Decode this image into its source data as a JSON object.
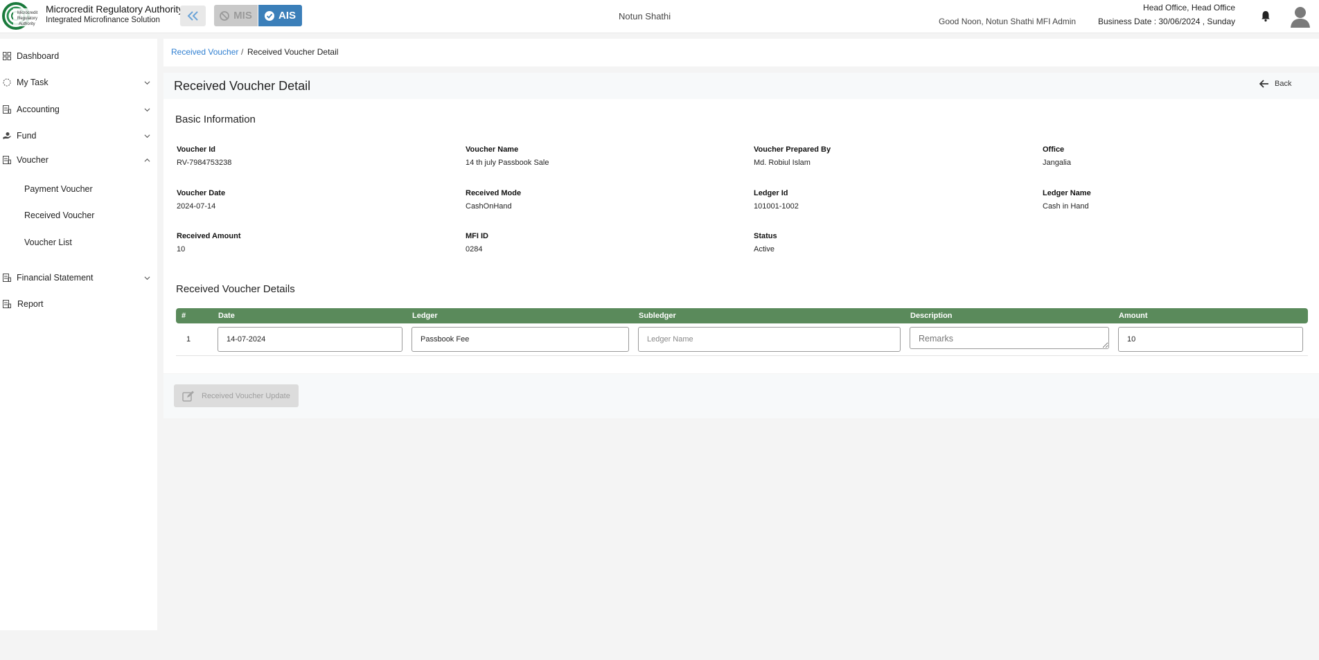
{
  "header": {
    "brand_title": "Microcredit Regulatory Authority",
    "brand_subtitle": "Integrated Microfinance Solution",
    "logo_text": "Microcredit Regulatory Authority",
    "mis_label": "MIS",
    "ais_label": "AIS",
    "org_name": "Notun Shathi",
    "greeting": "Good Noon, Notun Shathi MFI Admin",
    "office": "Head Office, Head Office",
    "business_date": "Business Date : 30/06/2024 , Sunday"
  },
  "sidebar": {
    "items": [
      {
        "label": "Dashboard"
      },
      {
        "label": "My Task"
      },
      {
        "label": "Accounting"
      },
      {
        "label": "Fund"
      },
      {
        "label": "Voucher"
      },
      {
        "label": "Financial Statement"
      },
      {
        "label": "Report"
      }
    ],
    "voucher_sub": [
      {
        "label": "Payment Voucher"
      },
      {
        "label": "Received Voucher"
      },
      {
        "label": "Voucher List"
      }
    ]
  },
  "breadcrumb": {
    "link": "Received Voucher",
    "separator": "/",
    "current": "Received Voucher Detail"
  },
  "page": {
    "title": "Received Voucher Detail",
    "back_label": "Back"
  },
  "basic_info": {
    "title": "Basic Information",
    "fields": [
      {
        "label": "Voucher Id",
        "value": "RV-7984753238"
      },
      {
        "label": "Voucher Name",
        "value": "14 th july Passbook Sale"
      },
      {
        "label": "Voucher Prepared By",
        "value": "Md. Robiul Islam"
      },
      {
        "label": "Office",
        "value": "Jangalia"
      },
      {
        "label": "Voucher Date",
        "value": "2024-07-14"
      },
      {
        "label": "Received Mode",
        "value": "CashOnHand"
      },
      {
        "label": "Ledger Id",
        "value": "101001-1002"
      },
      {
        "label": "Ledger Name",
        "value": "Cash in Hand"
      },
      {
        "label": "Received Amount",
        "value": "10"
      },
      {
        "label": "MFI ID",
        "value": "0284"
      },
      {
        "label": "Status",
        "value": "Active"
      }
    ]
  },
  "details": {
    "title": "Received Voucher Details",
    "columns": [
      "#",
      "Date",
      "Ledger",
      "Subledger",
      "Description",
      "Amount"
    ],
    "rows": [
      {
        "index": "1",
        "date": "14-07-2024",
        "ledger": "Passbook Fee",
        "subledger_placeholder": "Ledger Name",
        "description_placeholder": "Remarks",
        "amount": "10"
      }
    ]
  },
  "footer": {
    "update_label": "Received Voucher Update"
  },
  "colors": {
    "accent": "#3b7fb9",
    "table_header": "#5a8a5b",
    "link": "#2f7fd1"
  }
}
